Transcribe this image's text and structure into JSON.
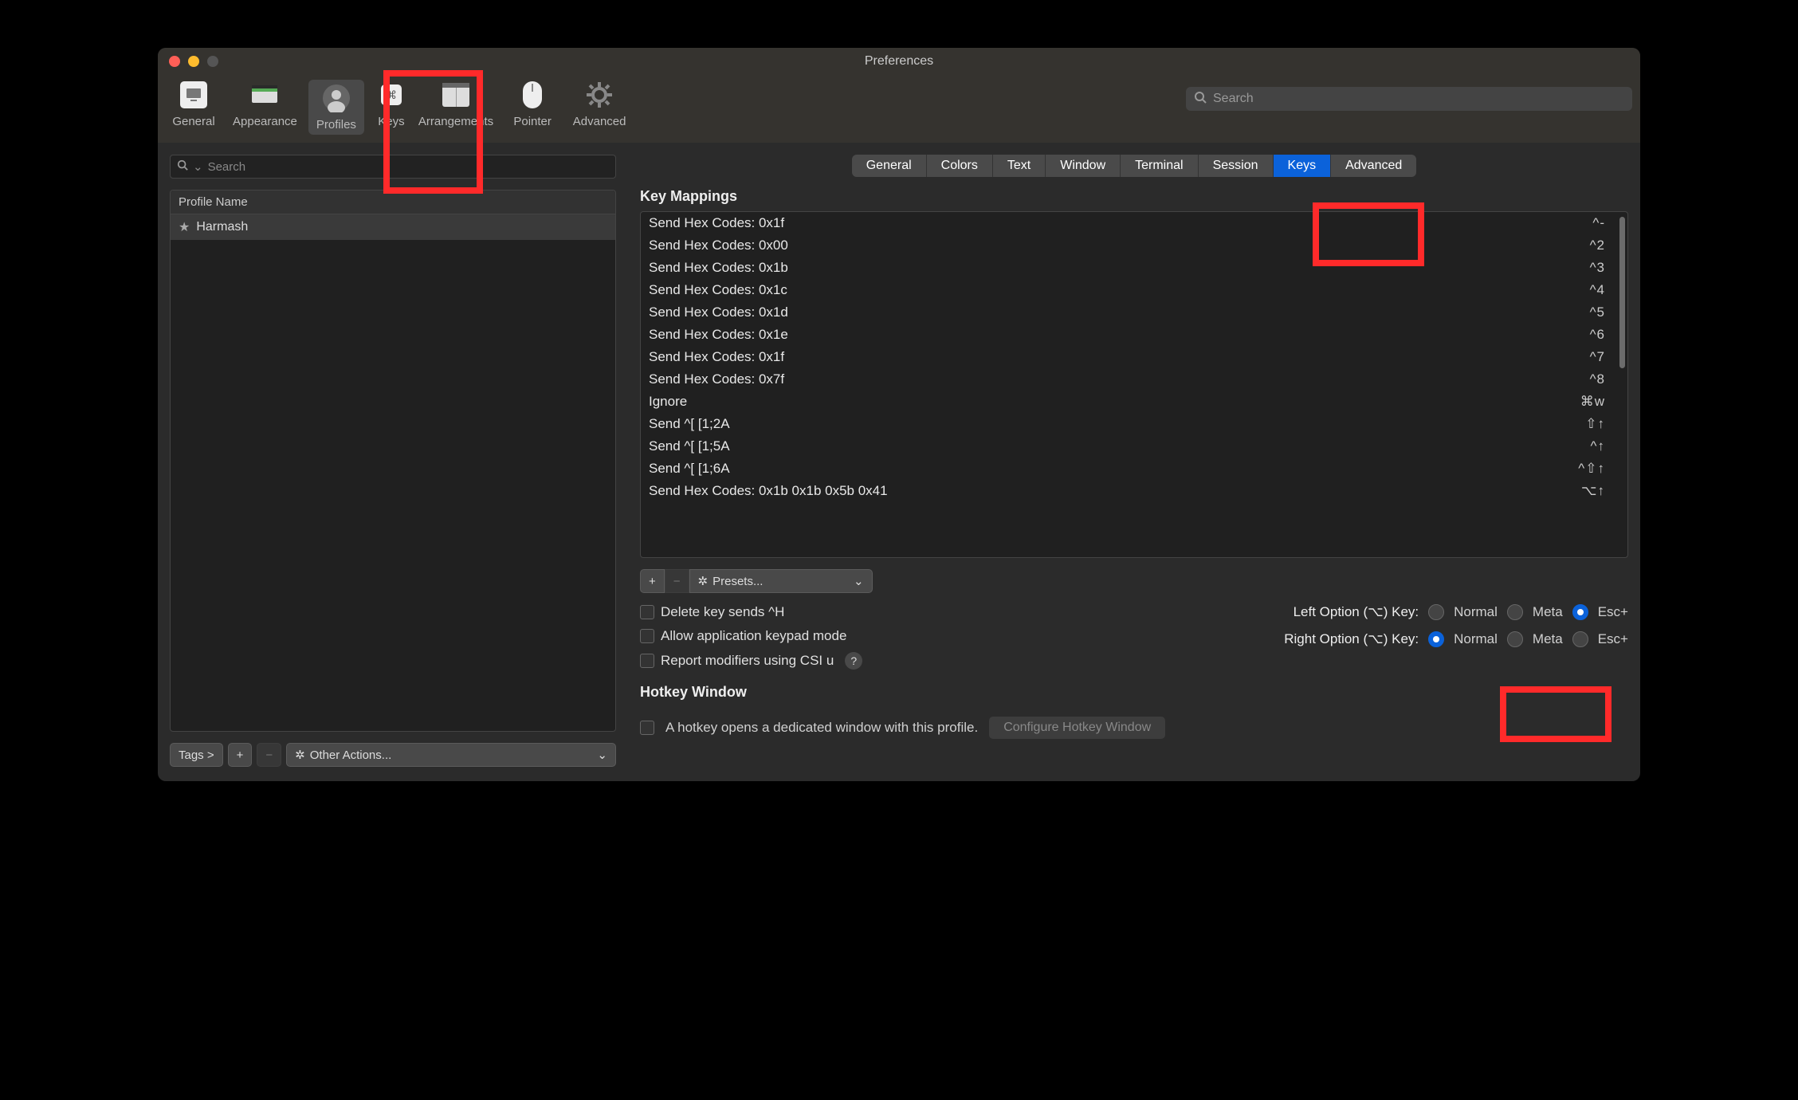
{
  "window_title": "Preferences",
  "toolbar": {
    "items": [
      {
        "label": "General"
      },
      {
        "label": "Appearance"
      },
      {
        "label": "Profiles"
      },
      {
        "label": "Keys"
      },
      {
        "label": "Arrangements"
      },
      {
        "label": "Pointer"
      },
      {
        "label": "Advanced"
      }
    ],
    "search_placeholder": "Search"
  },
  "sidebar": {
    "search_placeholder": "Search",
    "header": "Profile Name",
    "profiles": [
      {
        "name": "Harmash",
        "starred": true
      }
    ],
    "tags_label": "Tags >",
    "other_actions_label": "Other Actions..."
  },
  "tabs": [
    "General",
    "Colors",
    "Text",
    "Window",
    "Terminal",
    "Session",
    "Keys",
    "Advanced"
  ],
  "active_tab": "Keys",
  "key_mappings_title": "Key Mappings",
  "key_mappings": [
    {
      "action": "Send Hex Codes: 0x1f",
      "shortcut": "^-"
    },
    {
      "action": "Send Hex Codes: 0x00",
      "shortcut": "^2"
    },
    {
      "action": "Send Hex Codes: 0x1b",
      "shortcut": "^3"
    },
    {
      "action": "Send Hex Codes: 0x1c",
      "shortcut": "^4"
    },
    {
      "action": "Send Hex Codes: 0x1d",
      "shortcut": "^5"
    },
    {
      "action": "Send Hex Codes: 0x1e",
      "shortcut": "^6"
    },
    {
      "action": "Send Hex Codes: 0x1f",
      "shortcut": "^7"
    },
    {
      "action": "Send Hex Codes: 0x7f",
      "shortcut": "^8"
    },
    {
      "action": "Ignore",
      "shortcut": "⌘w"
    },
    {
      "action": "Send ^[ [1;2A",
      "shortcut": "⇧↑"
    },
    {
      "action": "Send ^[ [1;5A",
      "shortcut": "^↑"
    },
    {
      "action": "Send ^[ [1;6A",
      "shortcut": "^⇧↑"
    },
    {
      "action": "Send Hex Codes: 0x1b 0x1b 0x5b 0x41",
      "shortcut": "⌥↑"
    }
  ],
  "presets_label": "Presets...",
  "checkboxes": {
    "delete_key": "Delete key sends ^H",
    "keypad": "Allow application keypad mode",
    "csi_u": "Report modifiers using CSI u"
  },
  "option_keys": {
    "left_label": "Left Option (⌥) Key:",
    "right_label": "Right Option (⌥) Key:",
    "choices": [
      "Normal",
      "Meta",
      "Esc+"
    ],
    "left_selected": "Esc+",
    "right_selected": "Normal"
  },
  "hotkey": {
    "title": "Hotkey Window",
    "checkbox_label": "A hotkey opens a dedicated window with this profile.",
    "configure_label": "Configure Hotkey Window"
  }
}
